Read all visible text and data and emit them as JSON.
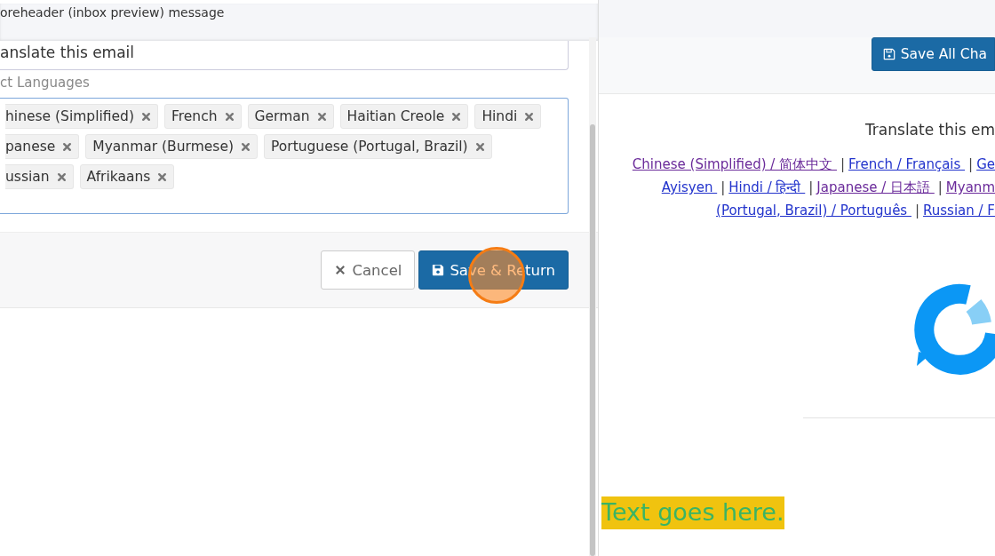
{
  "header": {
    "text": "oreheader (inbox preview) message"
  },
  "subject_field": {
    "value": "anslate this email"
  },
  "languages": {
    "label": "ct Languages",
    "tags": [
      {
        "label": "hinese (Simplified)"
      },
      {
        "label": "French"
      },
      {
        "label": "German"
      },
      {
        "label": "Haitian Creole"
      },
      {
        "label": "Hindi"
      },
      {
        "label": "panese"
      },
      {
        "label": "Myanmar (Burmese)"
      },
      {
        "label": "Portuguese (Portugal, Brazil)"
      },
      {
        "label": "ussian"
      },
      {
        "label": "Afrikaans"
      }
    ]
  },
  "buttons": [
    {
      "label": "Cancel",
      "kind": "cancel"
    },
    {
      "label": "Save & Return",
      "kind": "save"
    }
  ],
  "preview": {
    "save_all": "Save All Cha",
    "heading": "Translate this em",
    "link_lines": [
      [
        {
          "kind": "link",
          "text": "Chinese (Simplified) / 简体中文 ",
          "visited": true
        },
        {
          "kind": "sep",
          "text": "|"
        },
        {
          "kind": "link",
          "text": "French / Français ",
          "visited": false
        },
        {
          "kind": "sep",
          "text": "|"
        },
        {
          "kind": "link",
          "text": "Ge",
          "visited": false
        }
      ],
      [
        {
          "kind": "link",
          "text": "Ayisyen ",
          "visited": false
        },
        {
          "kind": "sep",
          "text": "|"
        },
        {
          "kind": "link",
          "text": "Hindi / हिन्दी ",
          "visited": false
        },
        {
          "kind": "sep",
          "text": "|"
        },
        {
          "kind": "link",
          "text": "Japanese / 日本語 ",
          "visited": true
        },
        {
          "kind": "sep",
          "text": "|"
        },
        {
          "kind": "link",
          "text": "Myanm",
          "visited": true
        }
      ],
      [
        {
          "kind": "link",
          "text": "(Portugal, Brazil) / Português ",
          "visited": false
        },
        {
          "kind": "sep",
          "text": "|"
        },
        {
          "kind": "link",
          "text": "Russian / F",
          "visited": false
        }
      ]
    ],
    "placeholder_text": "Text goes here."
  }
}
